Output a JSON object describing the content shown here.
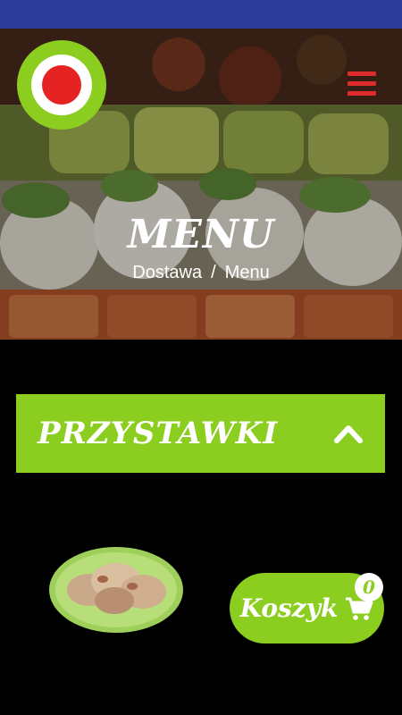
{
  "status_bar": {
    "color": "#2f3d9a"
  },
  "header": {
    "logo_icon": "italian-flag-logo-icon",
    "menu_icon": "hamburger-menu-icon",
    "title": "MENU",
    "breadcrumb": {
      "home": "Dostawa",
      "separator": "/",
      "current": "Menu"
    }
  },
  "category": {
    "label": "PRZYSTAWKI",
    "expanded": true,
    "icon": "chevron-up-icon"
  },
  "product": {
    "image_icon": "tempura-dish-icon"
  },
  "cart": {
    "label": "Koszyk",
    "count": "0",
    "icon": "shopping-cart-icon"
  },
  "colors": {
    "accent": "#8bce1f",
    "menu_red": "#e02b2b",
    "background": "#000000"
  }
}
